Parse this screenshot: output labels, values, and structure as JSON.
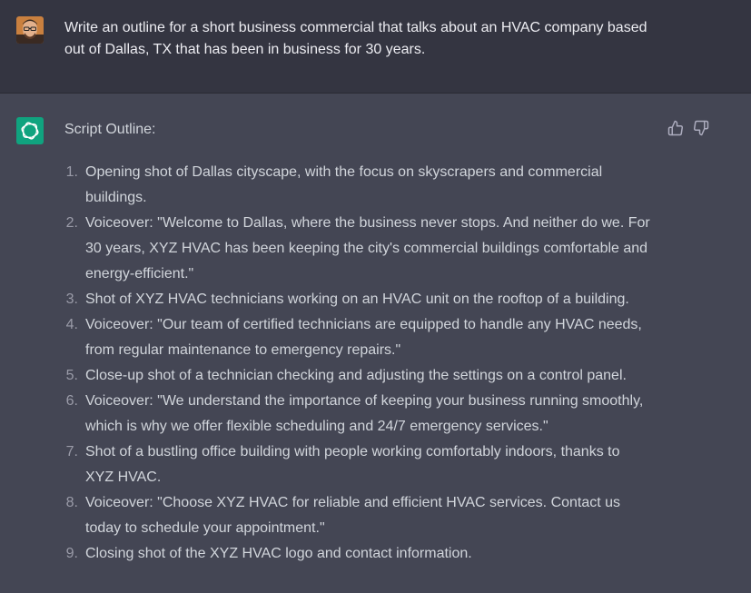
{
  "user": {
    "message": "Write an outline for a short business commercial that talks about an HVAC company based out of Dallas, TX that has been in business for 30 years.",
    "avatar_icon": "user-avatar-icon"
  },
  "assistant": {
    "logo_icon": "openai-logo-icon",
    "intro": "Script Outline:",
    "items": [
      {
        "num": "1.",
        "text": "Opening shot of Dallas cityscape, with the focus on skyscrapers and commercial buildings."
      },
      {
        "num": "2.",
        "text": "Voiceover: \"Welcome to Dallas, where the business never stops. And neither do we. For 30 years, XYZ HVAC has been keeping the city's commercial buildings comfortable and energy-efficient.\""
      },
      {
        "num": "3.",
        "text": "Shot of XYZ HVAC technicians working on an HVAC unit on the rooftop of a building."
      },
      {
        "num": "4.",
        "text": "Voiceover: \"Our team of certified technicians are equipped to handle any HVAC needs, from regular maintenance to emergency repairs.\""
      },
      {
        "num": "5.",
        "text": "Close-up shot of a technician checking and adjusting the settings on a control panel."
      },
      {
        "num": "6.",
        "text": "Voiceover: \"We understand the importance of keeping your business running smoothly, which is why we offer flexible scheduling and 24/7 emergency services.\""
      },
      {
        "num": "7.",
        "text": "Shot of a bustling office building with people working comfortably indoors, thanks to XYZ HVAC."
      },
      {
        "num": "8.",
        "text": "Voiceover: \"Choose XYZ HVAC for reliable and efficient HVAC services. Contact us today to schedule your appointment.\""
      },
      {
        "num": "9.",
        "text": "Closing shot of the XYZ HVAC logo and contact information."
      }
    ],
    "feedback": {
      "thumbs_up_icon": "thumbs-up-icon",
      "thumbs_down_icon": "thumbs-down-icon"
    }
  },
  "colors": {
    "user_bg": "#343541",
    "assistant_bg": "#444654",
    "brand": "#10a37f",
    "text": "#d1d5db"
  }
}
